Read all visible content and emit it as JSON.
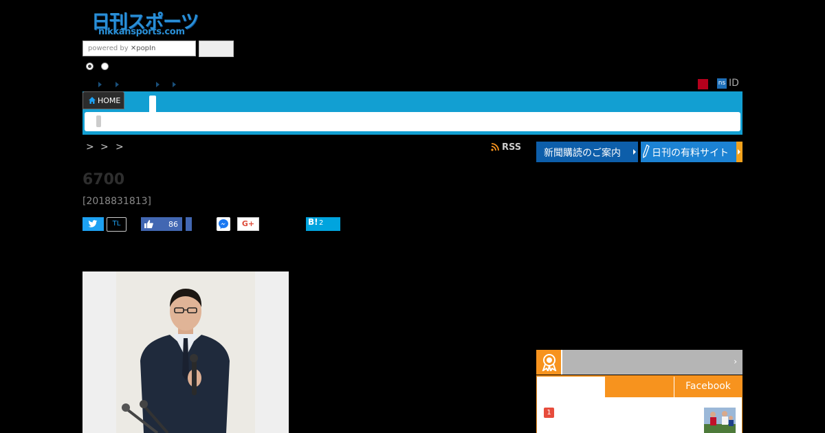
{
  "logo": {
    "main": "日刊スポーツ",
    "sub": "nikkansports.com"
  },
  "search": {
    "powered_by": "powered by",
    "brand": "popIn"
  },
  "header": {
    "ns_badge": "ns",
    "id_label": "ID"
  },
  "nav": {
    "home_label": "HOME"
  },
  "breadcrumb": {
    "sep1": ">",
    "sep2": ">",
    "sep3": ">"
  },
  "rss_label": "RSS",
  "banners": {
    "subscribe": "新聞購読のご案内",
    "paid_site": "日刊の有料サイト"
  },
  "article": {
    "headline": "6700",
    "dateline": "[2018831813]"
  },
  "social": {
    "tl_label": "TL",
    "like_count": "86",
    "gplus_label": "G+",
    "hatena_label": "B!",
    "hatena_count": "2"
  },
  "ranking": {
    "facebook_tab": "Facebook",
    "arrow": "›",
    "items": [
      {
        "rank": "1"
      }
    ]
  },
  "colors": {
    "nav_blue": "#129fd2",
    "accent_orange": "#f7931e",
    "twitter": "#1da1f2",
    "facebook": "#4267b2",
    "hatena": "#00a4de"
  }
}
